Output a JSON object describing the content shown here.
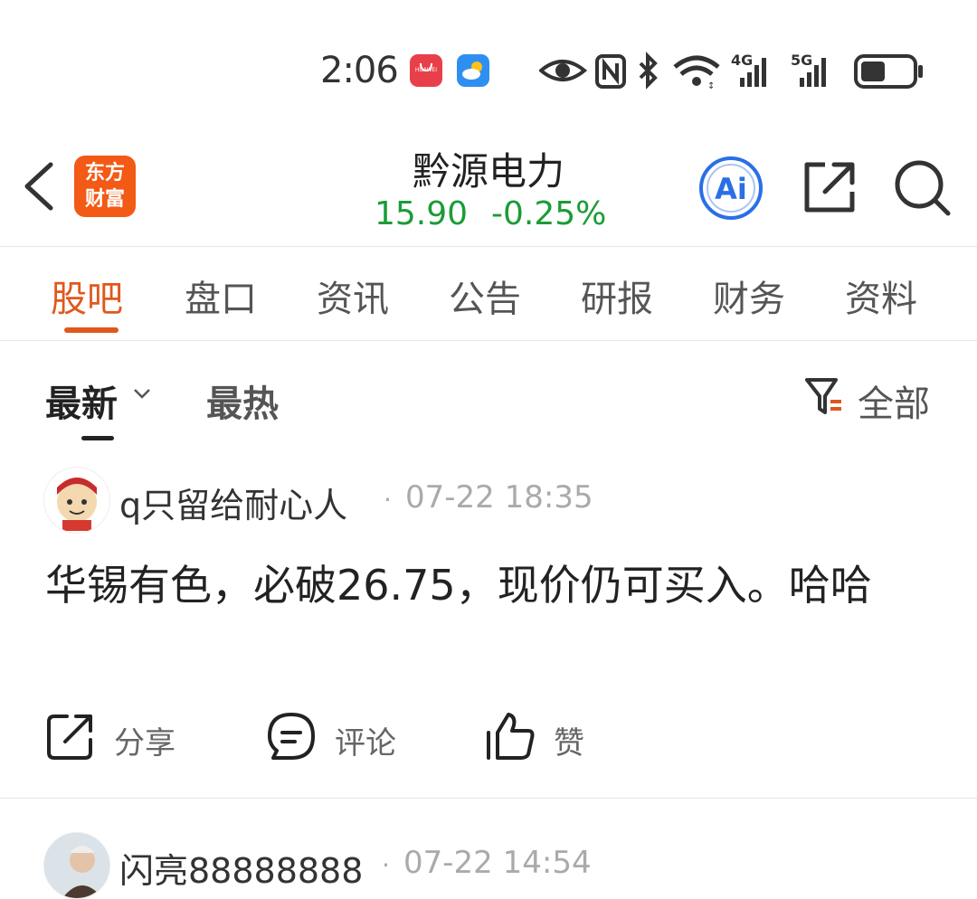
{
  "status_bar": {
    "time": "2:06",
    "huawei_label": "HUAWEI",
    "icons": [
      "huawei-appgallery-icon",
      "weather-icon",
      "eye-icon",
      "nfc-icon",
      "bluetooth-icon",
      "wifi-icon",
      "signal-4g-icon",
      "signal-5g-icon",
      "battery-icon"
    ],
    "network_4g": "4G",
    "network_5g": "5G"
  },
  "header": {
    "logo_line1": "东方",
    "logo_line2": "财富",
    "stock_name": "黔源电力",
    "price": "15.90",
    "change": "-0.25%",
    "ai_label": "Ai",
    "colors": {
      "brand": "#f25a16",
      "down": "#1a9c36",
      "ai": "#2a6fe6"
    }
  },
  "tabs": [
    {
      "label": "股吧",
      "active": true
    },
    {
      "label": "盘口",
      "active": false
    },
    {
      "label": "资讯",
      "active": false
    },
    {
      "label": "公告",
      "active": false
    },
    {
      "label": "研报",
      "active": false
    },
    {
      "label": "财务",
      "active": false
    },
    {
      "label": "资料",
      "active": false
    }
  ],
  "sort": {
    "latest_label": "最新",
    "hot_label": "最热",
    "filter_label": "全部"
  },
  "posts": [
    {
      "username": "q只留给耐心人",
      "time": "07-22 18:35",
      "text": "华锡有色，必破26.75，现价仍可买入。哈哈",
      "actions": {
        "share": "分享",
        "comment": "评论",
        "like": "赞"
      }
    },
    {
      "username": "闪亮88888888",
      "time": "07-22 14:54"
    }
  ]
}
